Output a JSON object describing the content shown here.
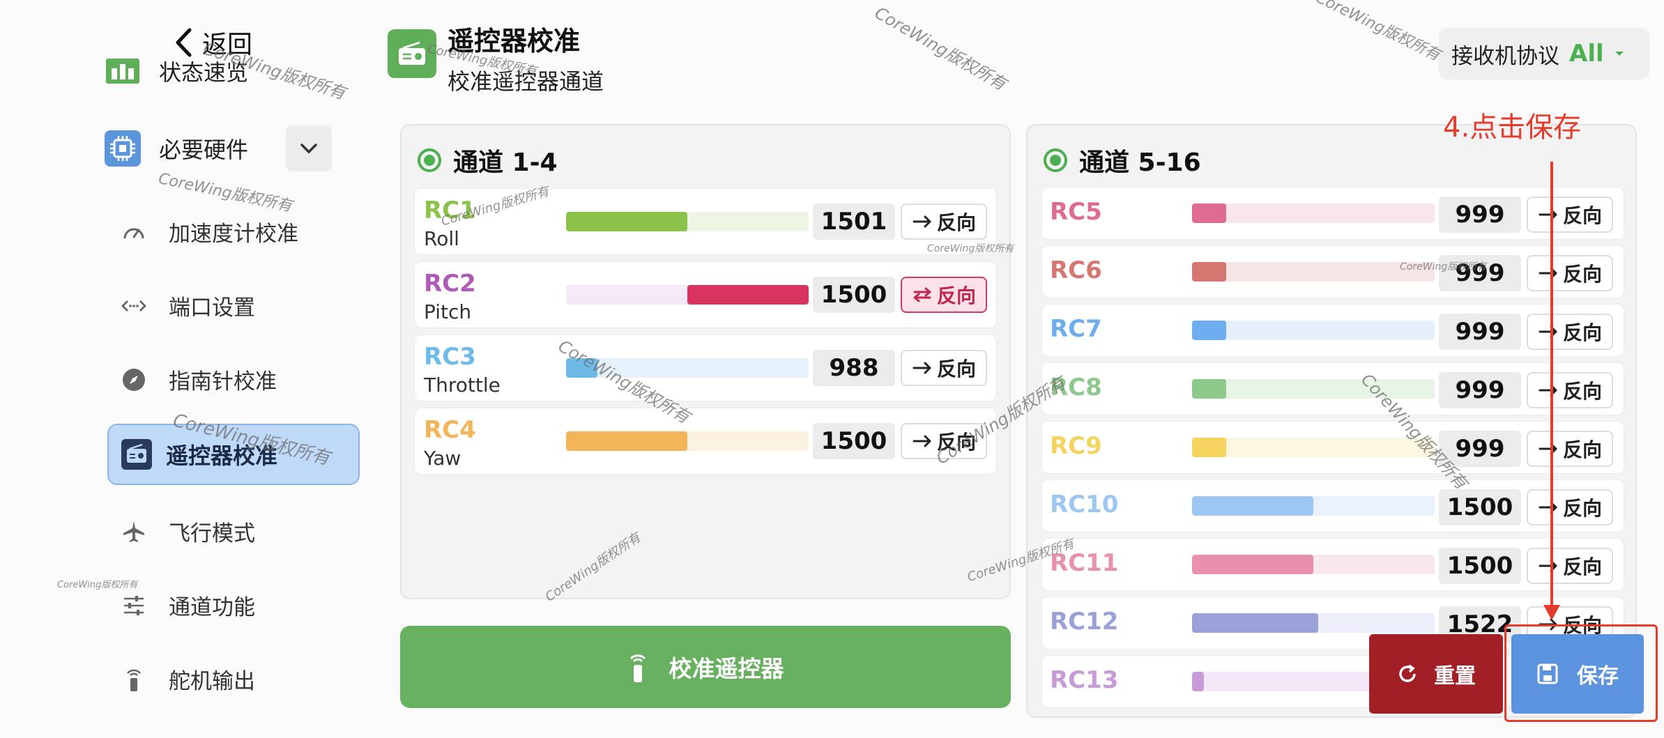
{
  "sidebar": {
    "back_label": "返回",
    "items": [
      {
        "label": "状态速览",
        "icon": "dashboard-icon"
      },
      {
        "label": "必要硬件",
        "icon": "chip-icon"
      }
    ],
    "sub_items": [
      {
        "label": "加速度计校准",
        "icon": "gauge-icon"
      },
      {
        "label": "端口设置",
        "icon": "port-icon"
      },
      {
        "label": "指南针校准",
        "icon": "compass-icon"
      },
      {
        "label": "遥控器校准",
        "icon": "radio-icon",
        "active": true
      },
      {
        "label": "飞行模式",
        "icon": "airplane-icon"
      },
      {
        "label": "通道功能",
        "icon": "sliders-icon"
      },
      {
        "label": "舵机输出",
        "icon": "servo-icon"
      }
    ]
  },
  "header": {
    "title": "遥控器校准",
    "subtitle": "校准遥控器通道",
    "protocol_label": "接收机协议",
    "protocol_value": "All"
  },
  "panel_left": {
    "title": "通道 1-4",
    "channels": [
      {
        "name": "RC1",
        "sub": "Roll",
        "value": "1501",
        "reverse_label": "反向",
        "reversed": false,
        "color": "#8bc34a",
        "track": "#edf5e4",
        "fill_start": 0.0,
        "fill_end": 0.5
      },
      {
        "name": "RC2",
        "sub": "Pitch",
        "value": "1500",
        "reverse_label": "反向",
        "reversed": true,
        "color": "#b05ab8",
        "track": "#f5e8f7",
        "fill_start": 0.5,
        "fill_end": 1.0,
        "fill_color": "#d9345f"
      },
      {
        "name": "RC3",
        "sub": "Throttle",
        "value": "988",
        "reverse_label": "反向",
        "reversed": false,
        "color": "#6fbbe8",
        "track": "#e5f1fb",
        "fill_start": 0.0,
        "fill_end": 0.13
      },
      {
        "name": "RC4",
        "sub": "Yaw",
        "value": "1500",
        "reverse_label": "反向",
        "reversed": false,
        "color": "#f3b55a",
        "track": "#fbf2e2",
        "fill_start": 0.0,
        "fill_end": 0.5
      }
    ]
  },
  "panel_right": {
    "title": "通道 5-16",
    "channels": [
      {
        "name": "RC5",
        "value": "999",
        "reverse_label": "反向",
        "color": "#e06b91",
        "track": "#f7e5ea",
        "fill": 0.14
      },
      {
        "name": "RC6",
        "value": "999",
        "reverse_label": "反向",
        "color": "#d67670",
        "track": "#f5e6e5",
        "fill": 0.14
      },
      {
        "name": "RC7",
        "value": "999",
        "reverse_label": "反向",
        "color": "#6eaef0",
        "track": "#e6f0fb",
        "fill": 0.14
      },
      {
        "name": "RC8",
        "value": "999",
        "reverse_label": "反向",
        "color": "#8cc98a",
        "track": "#e8f4e6",
        "fill": 0.14
      },
      {
        "name": "RC9",
        "value": "999",
        "reverse_label": "反向",
        "color": "#f4d35e",
        "track": "#fbf6e0",
        "fill": 0.14
      },
      {
        "name": "RC10",
        "value": "1500",
        "reverse_label": "反向",
        "color": "#9cc7f2",
        "track": "#e9f2fc",
        "fill": 0.5
      },
      {
        "name": "RC11",
        "value": "1500",
        "reverse_label": "反向",
        "color": "#e890ac",
        "track": "#f8e7ed",
        "fill": 0.5
      },
      {
        "name": "RC12",
        "value": "1522",
        "reverse_label": "反向",
        "color": "#9aa0d8",
        "track": "#eceef9",
        "fill": 0.52
      },
      {
        "name": "RC13",
        "value": "",
        "reverse_label": "",
        "color": "#c79ad8",
        "track": "#f3e8f7",
        "fill": 0.05
      }
    ]
  },
  "buttons": {
    "calibrate": "校准遥控器",
    "reset": "重置",
    "save": "保存"
  },
  "annotation": "4.点击保存",
  "watermark": "CoreWing版权所有"
}
